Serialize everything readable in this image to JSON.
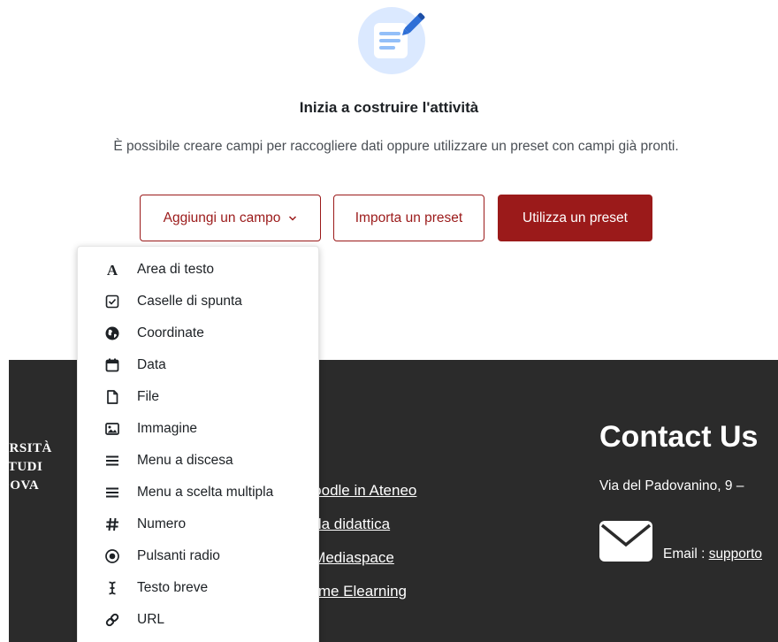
{
  "empty_state": {
    "heading": "Inizia a costruire l'attività",
    "description": "È possibile creare campi per raccogliere dati oppure utilizzare un preset con campi già pronti."
  },
  "actions": {
    "add_field": "Aggiungi un campo",
    "import_preset": "Importa un preset",
    "use_preset": "Utilizza un preset"
  },
  "field_menu": {
    "items": [
      {
        "label": "Area di testo",
        "icon": "text-area-icon"
      },
      {
        "label": "Caselle di spunta",
        "icon": "checkbox-icon"
      },
      {
        "label": "Coordinate",
        "icon": "globe-icon"
      },
      {
        "label": "Data",
        "icon": "calendar-icon"
      },
      {
        "label": "File",
        "icon": "file-icon"
      },
      {
        "label": "Immagine",
        "icon": "image-icon"
      },
      {
        "label": "Menu a discesa",
        "icon": "menu-lines-icon"
      },
      {
        "label": "Menu a scelta multipla",
        "icon": "menu-lines-icon"
      },
      {
        "label": "Numero",
        "icon": "hash-icon"
      },
      {
        "label": "Pulsanti radio",
        "icon": "radio-icon"
      },
      {
        "label": "Testo breve",
        "icon": "text-cursor-icon"
      },
      {
        "label": "URL",
        "icon": "link-icon"
      }
    ]
  },
  "footer": {
    "logo_lines": [
      "ERSITÀ",
      "STUDI",
      "DOVA"
    ],
    "links": [
      "Moodle in Ateneo",
      "er la didattica",
      "o Mediaspace",
      "forme Elearning"
    ],
    "contact_title": "Contact Us",
    "address": "Via del Padovanino, 9 –",
    "email_label": "Email : ",
    "email_link": "supporto"
  },
  "colors": {
    "brand": "#9b1a1a",
    "footer_bg": "#2b2b2b",
    "hero_icon_bg": "#dbe9ff",
    "hero_icon_fg": "#2f6fd6"
  }
}
